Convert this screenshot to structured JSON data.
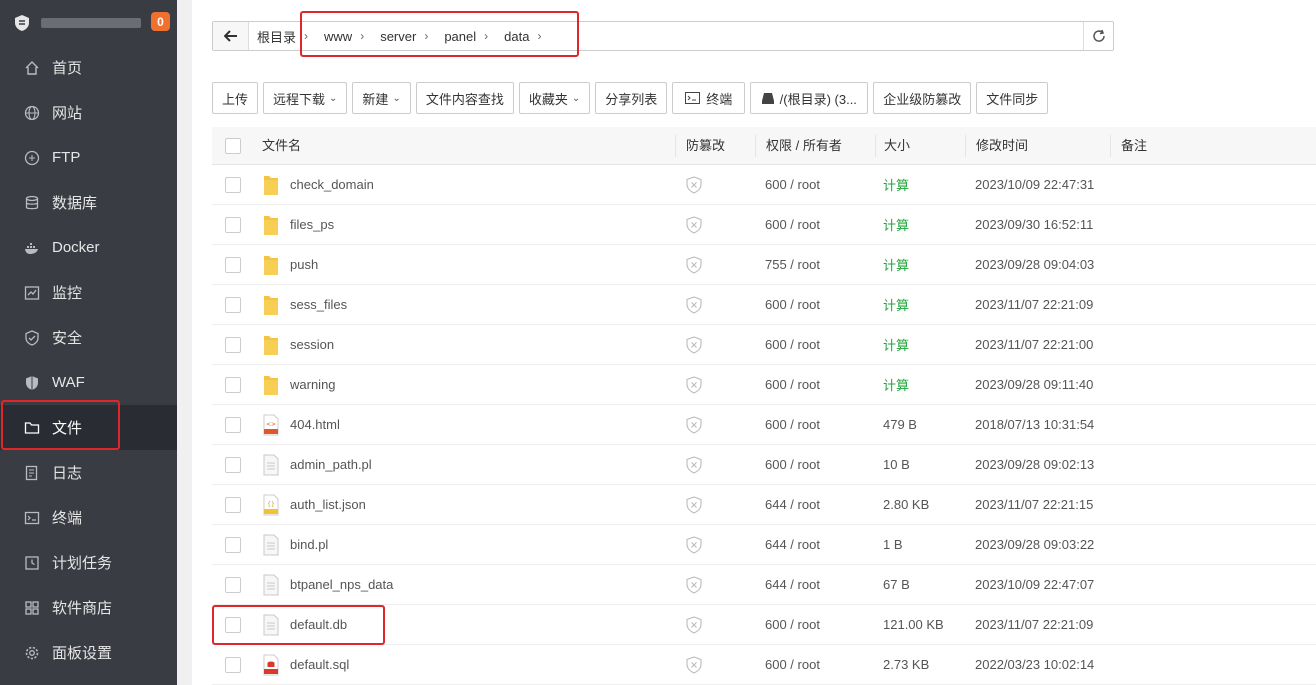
{
  "sidebar": {
    "badge": "0",
    "items": [
      {
        "label": "首页",
        "icon": "home-icon"
      },
      {
        "label": "网站",
        "icon": "globe-icon"
      },
      {
        "label": "FTP",
        "icon": "ftp-icon"
      },
      {
        "label": "数据库",
        "icon": "database-icon"
      },
      {
        "label": "Docker",
        "icon": "docker-icon"
      },
      {
        "label": "监控",
        "icon": "monitor-icon"
      },
      {
        "label": "安全",
        "icon": "shield-icon"
      },
      {
        "label": "WAF",
        "icon": "waf-shield-icon"
      },
      {
        "label": "文件",
        "icon": "folder-icon"
      },
      {
        "label": "日志",
        "icon": "log-icon"
      },
      {
        "label": "终端",
        "icon": "terminal-icon"
      },
      {
        "label": "计划任务",
        "icon": "clock-icon"
      },
      {
        "label": "软件商店",
        "icon": "grid-icon"
      },
      {
        "label": "面板设置",
        "icon": "gear-icon"
      }
    ],
    "active_index": 8
  },
  "path": {
    "crumbs": [
      "根目录",
      "www",
      "server",
      "panel",
      "data"
    ]
  },
  "toolbar": {
    "upload": "上传",
    "remote_download": "远程下载",
    "new": "新建",
    "content_search": "文件内容查找",
    "favorites": "收藏夹",
    "share_list": "分享列表",
    "terminal": "终端",
    "disk": "/(根目录) (3...",
    "tamper_proof": "企业级防篡改",
    "file_sync": "文件同步"
  },
  "table": {
    "headers": {
      "name": "文件名",
      "guard": "防篡改",
      "perm": "权限 / 所有者",
      "size": "大小",
      "mtime": "修改时间",
      "note": "备注"
    },
    "rows": [
      {
        "name": "check_domain",
        "type": "folder",
        "perm": "600 / root",
        "size": "计算",
        "mtime": "2023/10/09 22:47:31"
      },
      {
        "name": "files_ps",
        "type": "folder",
        "perm": "600 / root",
        "size": "计算",
        "mtime": "2023/09/30 16:52:11"
      },
      {
        "name": "push",
        "type": "folder",
        "perm": "755 / root",
        "size": "计算",
        "mtime": "2023/09/28 09:04:03"
      },
      {
        "name": "sess_files",
        "type": "folder",
        "perm": "600 / root",
        "size": "计算",
        "mtime": "2023/11/07 22:21:09"
      },
      {
        "name": "session",
        "type": "folder",
        "perm": "600 / root",
        "size": "计算",
        "mtime": "2023/11/07 22:21:00"
      },
      {
        "name": "warning",
        "type": "folder",
        "perm": "600 / root",
        "size": "计算",
        "mtime": "2023/09/28 09:11:40"
      },
      {
        "name": "404.html",
        "type": "html",
        "perm": "600 / root",
        "size": "479 B",
        "mtime": "2018/07/13 10:31:54"
      },
      {
        "name": "admin_path.pl",
        "type": "file",
        "perm": "600 / root",
        "size": "10 B",
        "mtime": "2023/09/28 09:02:13"
      },
      {
        "name": "auth_list.json",
        "type": "json",
        "perm": "644 / root",
        "size": "2.80 KB",
        "mtime": "2023/11/07 22:21:15"
      },
      {
        "name": "bind.pl",
        "type": "file",
        "perm": "644 / root",
        "size": "1 B",
        "mtime": "2023/09/28 09:03:22"
      },
      {
        "name": "btpanel_nps_data",
        "type": "file",
        "perm": "644 / root",
        "size": "67 B",
        "mtime": "2023/10/09 22:47:07"
      },
      {
        "name": "default.db",
        "type": "file",
        "perm": "600 / root",
        "size": "121.00 KB",
        "mtime": "2023/11/07 22:21:09"
      },
      {
        "name": "default.sql",
        "type": "sql",
        "perm": "600 / root",
        "size": "2.73 KB",
        "mtime": "2022/03/23 10:02:14"
      }
    ]
  },
  "colors": {
    "sidebar_bg": "#3a3c44",
    "active_bg": "#2a2c33",
    "accent_green": "#20a53a",
    "highlight_red": "#e0262a",
    "badge_orange": "#f0702e",
    "folder_yellow": "#f5c342"
  }
}
